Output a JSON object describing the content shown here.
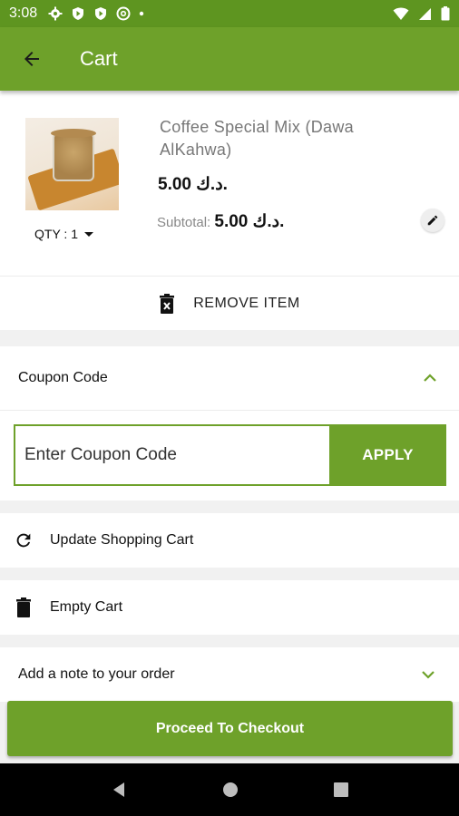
{
  "status_bar": {
    "time": "3:08"
  },
  "app_bar": {
    "title": "Cart",
    "back_icon": "arrow-left-icon"
  },
  "cart_item": {
    "name": "Coffee Special Mix (Dawa AlKahwa)",
    "quantity_label": "QTY : 1",
    "price": "5.00 د.ك.",
    "subtotal_label": "Subtotal:",
    "subtotal_value": "5.00 د.ك.",
    "remove_label": "REMOVE ITEM"
  },
  "coupon": {
    "title": "Coupon Code",
    "placeholder": "Enter Coupon Code",
    "apply_label": "APPLY"
  },
  "actions": {
    "update_label": "Update Shopping Cart",
    "empty_label": "Empty Cart",
    "note_label": "Add a note to your order"
  },
  "checkout_label": "Proceed To Checkout",
  "colors": {
    "primary": "#6ea12a",
    "status_bar": "#5e9520"
  }
}
